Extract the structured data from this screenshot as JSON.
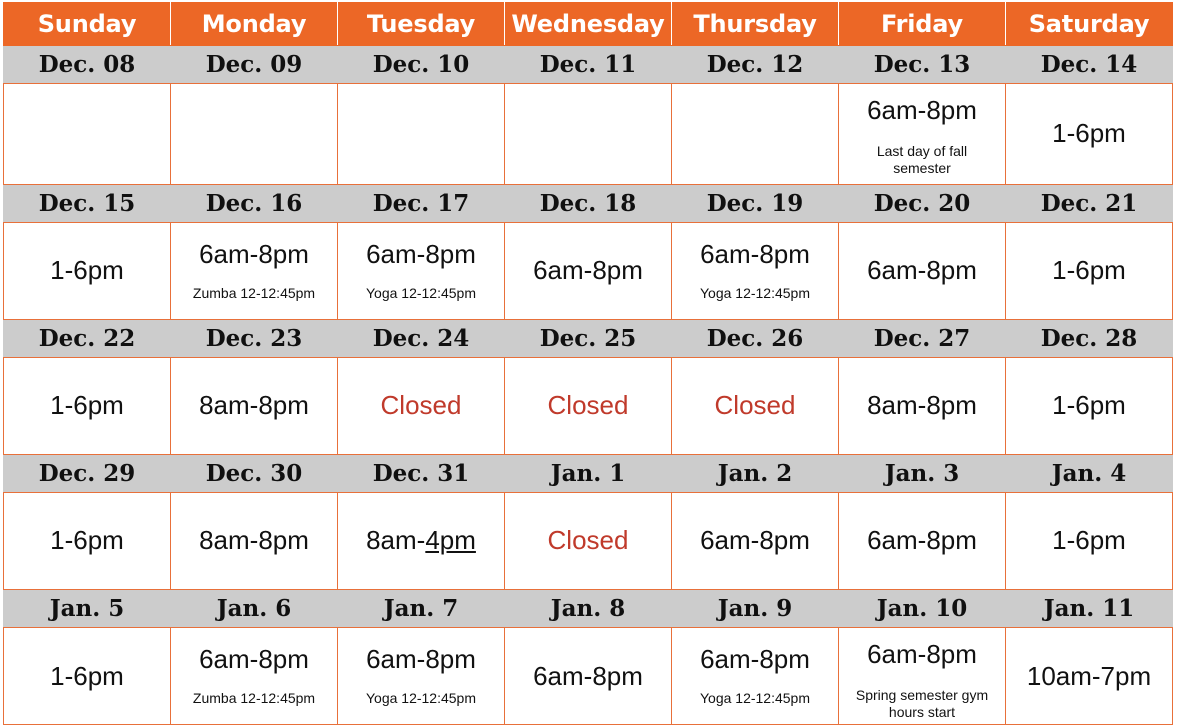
{
  "header": {
    "accent_color": "#EC6726",
    "date_band_color": "#CCCCCC",
    "closed_color": "#C03A2B",
    "weekdays": [
      "Sunday",
      "Monday",
      "Tuesday",
      "Wednesday",
      "Thursday",
      "Friday",
      "Saturday"
    ]
  },
  "weeks": [
    {
      "dates": [
        "Dec. 08",
        "Dec. 09",
        "Dec. 10",
        "Dec. 11",
        "Dec. 12",
        "Dec. 13",
        "Dec. 14"
      ],
      "cells": [
        {
          "hours": "",
          "note": ""
        },
        {
          "hours": "",
          "note": ""
        },
        {
          "hours": "",
          "note": ""
        },
        {
          "hours": "",
          "note": ""
        },
        {
          "hours": "",
          "note": ""
        },
        {
          "hours": "6am-8pm",
          "note": "Last day of fall semester",
          "note_wrap": true
        },
        {
          "hours": "1-6pm",
          "note": ""
        }
      ]
    },
    {
      "dates": [
        "Dec. 15",
        "Dec. 16",
        "Dec. 17",
        "Dec. 18",
        "Dec. 19",
        "Dec. 20",
        "Dec. 21"
      ],
      "cells": [
        {
          "hours": "1-6pm",
          "note": ""
        },
        {
          "hours": "6am-8pm",
          "note": "Zumba 12-12:45pm"
        },
        {
          "hours": "6am-8pm",
          "note": "Yoga 12-12:45pm"
        },
        {
          "hours": "6am-8pm",
          "note": ""
        },
        {
          "hours": "6am-8pm",
          "note": "Yoga 12-12:45pm"
        },
        {
          "hours": "6am-8pm",
          "note": ""
        },
        {
          "hours": "1-6pm",
          "note": ""
        }
      ]
    },
    {
      "dates": [
        "Dec. 22",
        "Dec. 23",
        "Dec. 24",
        "Dec. 25",
        "Dec. 26",
        "Dec. 27",
        "Dec. 28"
      ],
      "cells": [
        {
          "hours": "1-6pm",
          "note": ""
        },
        {
          "hours": "8am-8pm",
          "note": ""
        },
        {
          "hours": "Closed",
          "closed": true,
          "note": ""
        },
        {
          "hours": "Closed",
          "closed": true,
          "note": ""
        },
        {
          "hours": "Closed",
          "closed": true,
          "note": ""
        },
        {
          "hours": "8am-8pm",
          "note": ""
        },
        {
          "hours": "1-6pm",
          "note": ""
        }
      ]
    },
    {
      "dates": [
        "Dec. 29",
        "Dec. 30",
        "Dec. 31",
        "Jan. 1",
        "Jan. 2",
        "Jan. 3",
        "Jan. 4"
      ],
      "cells": [
        {
          "hours": "1-6pm",
          "note": ""
        },
        {
          "hours": "8am-8pm",
          "note": ""
        },
        {
          "hours": "8am-4pm",
          "underline_tail": "4pm",
          "note": ""
        },
        {
          "hours": "Closed",
          "closed": true,
          "note": ""
        },
        {
          "hours": "6am-8pm",
          "note": ""
        },
        {
          "hours": "6am-8pm",
          "note": ""
        },
        {
          "hours": "1-6pm",
          "note": ""
        }
      ]
    },
    {
      "dates": [
        "Jan. 5",
        "Jan. 6",
        "Jan. 7",
        "Jan. 8",
        "Jan. 9",
        "Jan. 10",
        "Jan. 11"
      ],
      "cells": [
        {
          "hours": "1-6pm",
          "note": ""
        },
        {
          "hours": "6am-8pm",
          "note": "Zumba 12-12:45pm"
        },
        {
          "hours": "6am-8pm",
          "note": "Yoga 12-12:45pm"
        },
        {
          "hours": "6am-8pm",
          "note": ""
        },
        {
          "hours": "6am-8pm",
          "note": "Yoga 12-12:45pm"
        },
        {
          "hours": "6am-8pm",
          "note": "Spring semester gym hours start",
          "note_wrap": true
        },
        {
          "hours": "10am-7pm",
          "note": ""
        }
      ]
    }
  ]
}
